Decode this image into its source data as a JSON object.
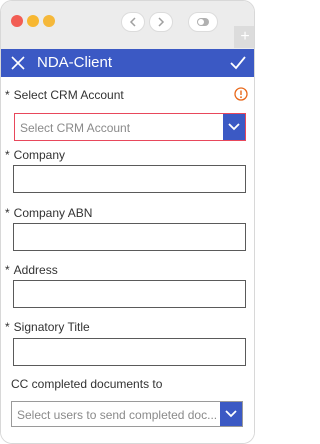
{
  "window": {
    "traffic_lights": [
      "red",
      "yellow",
      "green"
    ],
    "colors": {
      "red": "#f25d54",
      "yellow": "#f7b731",
      "green": "#f5b83a"
    },
    "new_tab_label": "+"
  },
  "header": {
    "title": "NDA-Client",
    "close_icon": "close-icon",
    "confirm_icon": "check-icon",
    "background": "#3b59c4"
  },
  "form": {
    "crm_account": {
      "label": "Select CRM Account",
      "required_mark": "*",
      "placeholder": "Select CRM Account",
      "warning_icon": "exclamation-circle-icon",
      "warning_color": "#e8681a",
      "error_border": "#e8475b"
    },
    "company": {
      "label": "Company",
      "required_mark": "*",
      "value": ""
    },
    "company_abn": {
      "label": "Company ABN",
      "required_mark": "*",
      "value": ""
    },
    "address": {
      "label": "Address",
      "required_mark": "*",
      "value": ""
    },
    "signatory_title": {
      "label": "Signatory Title",
      "required_mark": "*",
      "value": ""
    },
    "cc_users": {
      "label": "CC completed documents to",
      "placeholder": "Select users to send completed doc..."
    }
  }
}
